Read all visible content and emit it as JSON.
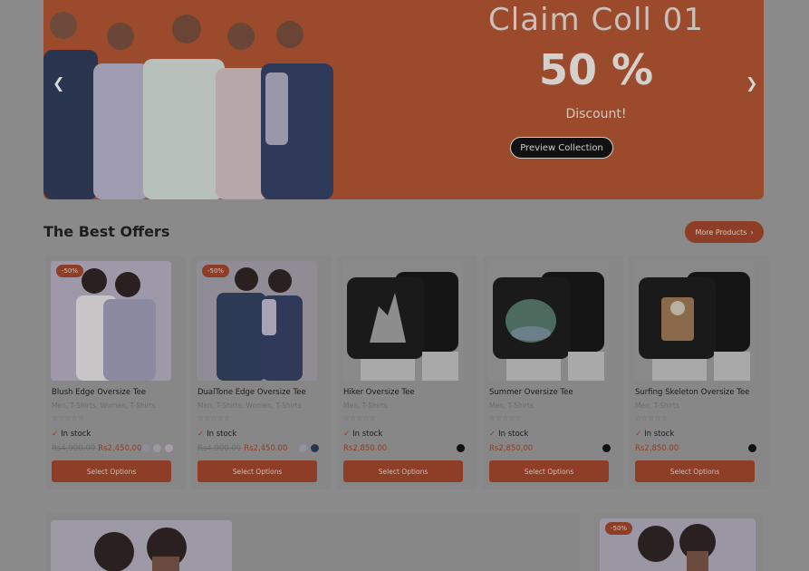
{
  "hero": {
    "title": "Claim Coll 01",
    "discount": "50 %",
    "subtitle": "Discount!",
    "button": "Preview Collection"
  },
  "section": {
    "title": "The Best Offers",
    "more_button": "More Products"
  },
  "products": [
    {
      "badge": "-50%",
      "name": "Blush Edge Oversize Tee",
      "categories": "Men, T-Shirts, Women, T-Shirts",
      "stock": "In stock",
      "old_price": "Rs4,900.00",
      "price": "Rs2,450.00",
      "button": "Select Options",
      "swatches": [
        "#8e8c9c",
        "#9a9a9e",
        "#a59ea6"
      ],
      "rating": 0
    },
    {
      "badge": "-50%",
      "name": "DualTone Edge Oversize Tee",
      "categories": "Men, T-Shirts, Women, T-Shirts",
      "stock": "In stock",
      "old_price": "Rs4,900.00",
      "price": "Rs2,450.00",
      "button": "Select Options",
      "swatches": [
        "#9491a0",
        "#2a3550"
      ],
      "rating": 0
    },
    {
      "badge": "",
      "name": "Hiker Oversize Tee",
      "categories": "Men, T-Shirts",
      "stock": "In stock",
      "old_price": "",
      "price": "Rs2,850.00",
      "button": "Select Options",
      "swatches": [
        "#111111"
      ],
      "rating": 0
    },
    {
      "badge": "",
      "name": "Summer Oversize Tee",
      "categories": "Men, T-Shirts",
      "stock": "In stock",
      "old_price": "",
      "price": "Rs2,850.00",
      "button": "Select Options",
      "swatches": [
        "#111111"
      ],
      "rating": 0
    },
    {
      "badge": "",
      "name": "Surfing Skeleton Oversize Tee",
      "categories": "Men, T-Shirts",
      "stock": "In stock",
      "old_price": "",
      "price": "Rs2,850.00",
      "button": "Select Options",
      "swatches": [
        "#111111"
      ],
      "rating": 0
    }
  ],
  "bottom": {
    "badge": "-50%"
  },
  "colors": {
    "accent": "#8e3d26",
    "hero_bg": "#9c4a2c",
    "page_bg": "#8a8a8a"
  },
  "icons": {
    "prev": "chevron-left-icon",
    "next": "chevron-right-icon",
    "stock": "check-icon",
    "star": "star-icon"
  }
}
